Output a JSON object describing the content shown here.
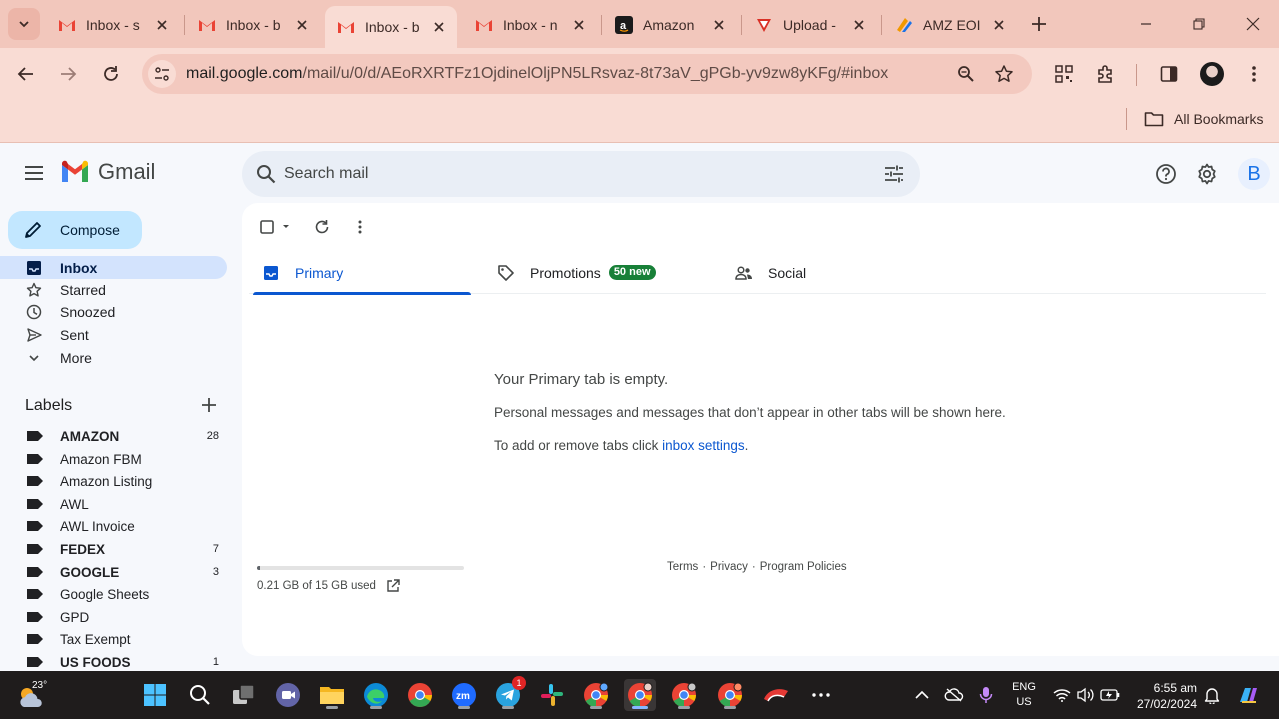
{
  "browser": {
    "tabs": [
      {
        "title": "Inbox - s",
        "favicon": "gmail-icon",
        "active": false
      },
      {
        "title": "Inbox - b",
        "favicon": "gmail-icon",
        "active": false
      },
      {
        "title": "Inbox - b",
        "favicon": "gmail-icon",
        "active": true
      },
      {
        "title": "Inbox - n",
        "favicon": "gmail-icon",
        "active": false
      },
      {
        "title": "Amazon",
        "favicon": "amazon-icon",
        "active": false
      },
      {
        "title": "Upload -",
        "favicon": "upload-app-icon",
        "active": false
      },
      {
        "title": "AMZ EOI",
        "favicon": "amz-eoi-icon",
        "active": false
      }
    ],
    "url_host": "mail.google.com",
    "url_path": "/mail/u/0/d/AEoRXRTFz1OjdinelOljPN5LRsvaz-8t73aV_gPGb-yv9zw8yKFg/#inbox",
    "bookmarks_label": "All Bookmarks"
  },
  "gmail": {
    "brand": "Gmail",
    "search_placeholder": "Search mail",
    "avatar_letter": "B",
    "compose_label": "Compose",
    "nav": [
      {
        "label": "Inbox",
        "icon": "inbox-icon",
        "active": true
      },
      {
        "label": "Starred",
        "icon": "star-icon",
        "active": false
      },
      {
        "label": "Snoozed",
        "icon": "clock-icon",
        "active": false
      },
      {
        "label": "Sent",
        "icon": "send-icon",
        "active": false
      },
      {
        "label": "More",
        "icon": "chevron-down-icon",
        "active": false
      }
    ],
    "labels_title": "Labels",
    "labels": [
      {
        "name": "AMAZON",
        "count": "28",
        "bold": true
      },
      {
        "name": "Amazon FBM",
        "count": "",
        "bold": false
      },
      {
        "name": "Amazon Listing",
        "count": "",
        "bold": false
      },
      {
        "name": "AWL",
        "count": "",
        "bold": false
      },
      {
        "name": "AWL Invoice",
        "count": "",
        "bold": false
      },
      {
        "name": "FEDEX",
        "count": "7",
        "bold": true
      },
      {
        "name": "GOOGLE",
        "count": "3",
        "bold": true
      },
      {
        "name": "Google Sheets",
        "count": "",
        "bold": false
      },
      {
        "name": "GPD",
        "count": "",
        "bold": false
      },
      {
        "name": "Tax Exempt",
        "count": "",
        "bold": false
      },
      {
        "name": "US FOODS",
        "count": "1",
        "bold": true
      }
    ],
    "category_tabs": [
      {
        "label": "Primary",
        "icon": "inbox-icon",
        "active": true,
        "badge": ""
      },
      {
        "label": "Promotions",
        "icon": "tag-icon",
        "active": false,
        "badge": "50 new"
      },
      {
        "label": "Social",
        "icon": "people-icon",
        "active": false,
        "badge": ""
      }
    ],
    "empty": {
      "title": "Your Primary tab is empty.",
      "line1": "Personal messages and messages that don’t appear in other tabs will be shown here.",
      "line2_prefix": "To add or remove tabs click ",
      "line2_link": "inbox settings",
      "line2_suffix": "."
    },
    "storage": {
      "text": "0.21 GB of 15 GB used",
      "fraction": 0.014
    },
    "footer": {
      "terms": "Terms",
      "privacy": "Privacy",
      "policies": "Program Policies",
      "sep": "·"
    }
  },
  "taskbar": {
    "temperature": "23°",
    "telegram_badge": "1",
    "lang_line1": "ENG",
    "lang_line2": "US",
    "time": "6:55 am",
    "date": "27/02/2024"
  },
  "colors": {
    "chrome_bg": "#f2c7bc",
    "toolbar_bg": "#f9dcd4",
    "gmail_bg": "#f6f8fc",
    "compose_bg": "#c2e7ff",
    "active_nav_bg": "#d3e3fd",
    "accent_blue": "#0b57d0",
    "badge_green": "#188038"
  }
}
